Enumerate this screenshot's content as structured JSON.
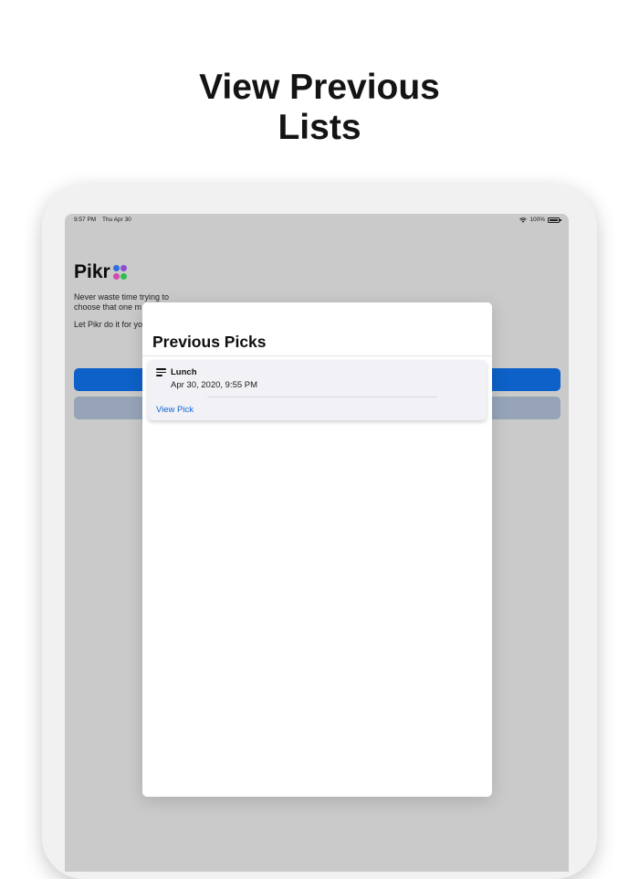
{
  "headline": {
    "line1": "View Previous",
    "line2": "Lists"
  },
  "status_bar": {
    "time": "9:57 PM",
    "date": "Thu Apr 30",
    "battery": "100%"
  },
  "app": {
    "title": "Pikr",
    "logo_colors": [
      "#2f6fe0",
      "#8a4fd0",
      "#d44ab0",
      "#2fbf4f"
    ],
    "tagline_lines": [
      "Never waste time trying to",
      "choose that one m"
    ],
    "tagline2": "Let Pikr do it for yo",
    "primary_color": "#0e61c8",
    "secondary_color": "#97a4b8"
  },
  "modal": {
    "title": "Previous Picks",
    "picks": [
      {
        "icon": "list-icon",
        "name": "Lunch",
        "date": "Apr 30, 2020, 9:55 PM",
        "action": "View Pick"
      }
    ]
  }
}
